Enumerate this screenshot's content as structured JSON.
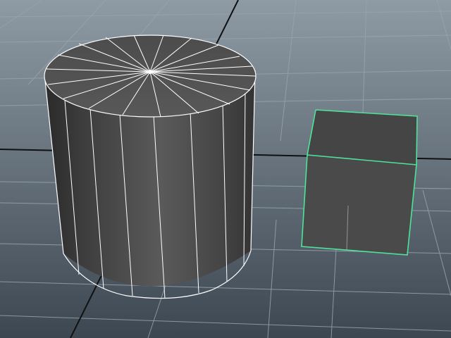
{
  "viewport": {
    "kind": "3d-perspective-viewport",
    "background_top": "#8e9aa4",
    "background_bottom": "#3c4752",
    "grid_color": "#9aa3ab",
    "axis_color": "#111111",
    "wireframe_color": "#ffffff",
    "selection_color": "#4ee39a"
  },
  "objects": [
    {
      "id": "cylinder",
      "type": "cylinder-mesh",
      "selected": false,
      "subdivisions_axis": 20,
      "shading": "wireframe-on-shaded"
    },
    {
      "id": "cube",
      "type": "cube-mesh",
      "selected": true,
      "shading": "wireframe-on-shaded"
    }
  ]
}
